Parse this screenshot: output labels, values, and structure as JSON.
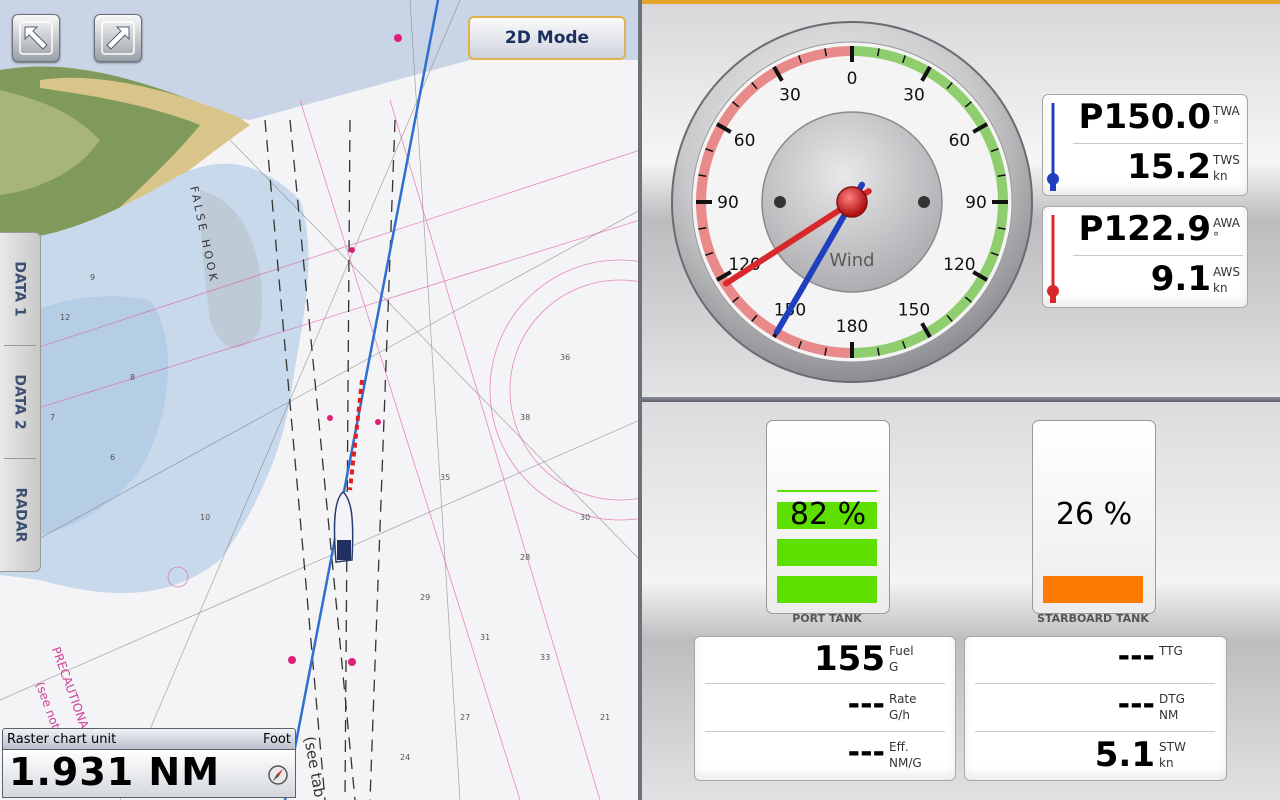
{
  "map": {
    "mode_button": "2D Mode",
    "side_tabs": [
      "DATA 1",
      "DATA 2",
      "RADAR"
    ],
    "chart_labels": {
      "false_hook": "FALSE HOOK",
      "precautionary": "PRECAUTIONARY",
      "see_note": "(see note",
      "see_tab": "(see tab"
    },
    "scale": {
      "label": "Raster chart unit",
      "unit": "Foot",
      "value": "1.931 NM"
    }
  },
  "wind_gauge": {
    "title": "Wind",
    "scale_left": [
      "30",
      "60",
      "90",
      "120",
      "150"
    ],
    "scale_right": [
      "30",
      "60",
      "90",
      "120",
      "150"
    ],
    "scale_top": "0",
    "scale_bottom": "180",
    "true_angle_deg": 210,
    "apparent_angle_deg": 237.1
  },
  "wind_readouts": [
    {
      "color": "#1f3fbf",
      "angle_value": "P150.0",
      "angle_label": "TWA",
      "angle_unit": "°",
      "speed_value": "15.2",
      "speed_label": "TWS",
      "speed_unit": "kn"
    },
    {
      "color": "#d8282b",
      "angle_value": "P122.9",
      "angle_label": "AWA",
      "angle_unit": "°",
      "speed_value": "9.1",
      "speed_label": "AWS",
      "speed_unit": "kn"
    }
  ],
  "tanks": [
    {
      "name": "PORT TANK",
      "percent_text": "82 %",
      "level": 0.82,
      "color": "#5de000"
    },
    {
      "name": "STARBOARD TANK",
      "percent_text": "26 %",
      "level": 0.26,
      "color": "#ff7a00"
    }
  ],
  "fuel_data": [
    {
      "value": "155",
      "label": "Fuel",
      "unit": "G"
    },
    {
      "value": "---",
      "label": "Rate",
      "unit": "G/h"
    },
    {
      "value": "---",
      "label": "Eff.",
      "unit": "NM/G"
    }
  ],
  "route_data": [
    {
      "value": "---",
      "label": "TTG",
      "unit": ""
    },
    {
      "value": "---",
      "label": "DTG",
      "unit": "NM"
    },
    {
      "value": "5.1",
      "label": "STW",
      "unit": "kn"
    }
  ]
}
